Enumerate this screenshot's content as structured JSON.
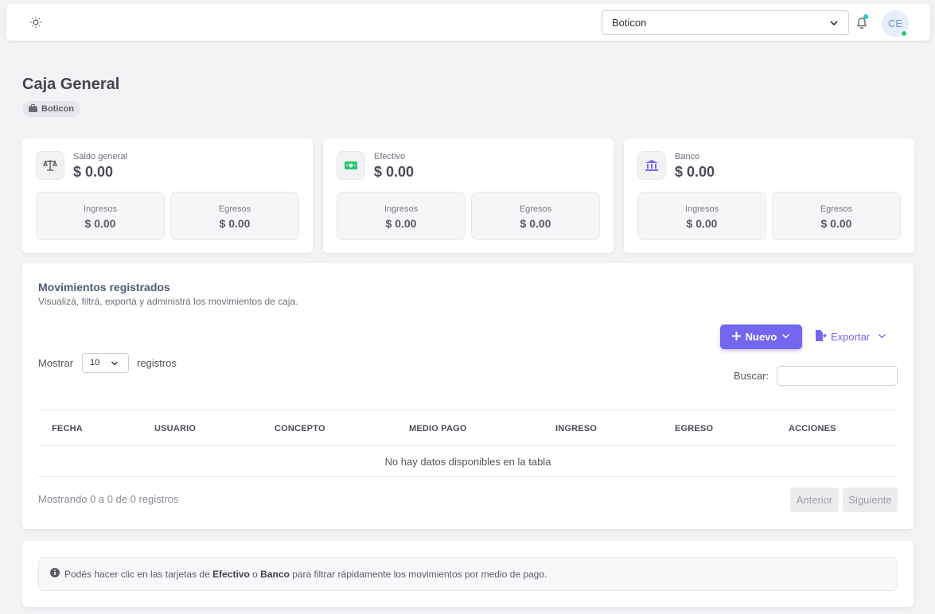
{
  "navbar": {
    "theme_icon": "sun-icon",
    "company_select": {
      "value": "Boticon"
    },
    "notifications_icon": "bell-icon",
    "avatar_initials": "CE",
    "colors": {
      "avatar_bg": "#e6eefb",
      "status_online": "#28c76f",
      "bell_dot": "#22c3d6"
    }
  },
  "page": {
    "title": "Caja General",
    "company_badge": "Boticon"
  },
  "summary_cards": [
    {
      "key": "general",
      "icon": "scale-icon",
      "label": "Saldo general",
      "value": "$ 0.00",
      "ingresos_label": "Ingresos",
      "ingresos_value": "$ 0.00",
      "egresos_label": "Egresos",
      "egresos_value": "$ 0.00"
    },
    {
      "key": "efectivo",
      "icon": "cash-icon",
      "label": "Efectivo",
      "value": "$ 0.00",
      "ingresos_label": "Ingresos",
      "ingresos_value": "$ 0.00",
      "egresos_label": "Egresos",
      "egresos_value": "$ 0.00"
    },
    {
      "key": "banco",
      "icon": "bank-icon",
      "label": "Banco",
      "value": "$ 0.00",
      "ingresos_label": "Ingresos",
      "ingresos_value": "$ 0.00",
      "egresos_label": "Egresos",
      "egresos_value": "$ 0.00"
    }
  ],
  "movements": {
    "title": "Movimientos registrados",
    "subtitle": "Visualizá, filtrá, exportá y administrá los movimientos de caja.",
    "new_button": "Nuevo",
    "export_button": "Exportar",
    "length_prefix": "Mostrar",
    "length_value": "10",
    "length_suffix": "registros",
    "search_label": "Buscar:",
    "columns": [
      "FECHA",
      "USUARIO",
      "CONCEPTO",
      "MEDIO PAGO",
      "INGRESO",
      "EGRESO",
      "ACCIONES"
    ],
    "empty_message": "No hay datos disponibles en la tabla",
    "info": "Mostrando 0 a 0 de 0 registros",
    "prev_button": "Anterior",
    "next_button": "Siguiente",
    "accent": "#7367f0"
  },
  "tip": {
    "icon": "info-icon",
    "text_1": "Podés hacer clic en las tarjetas de",
    "bold_1": "Efectivo",
    "text_2": "o",
    "bold_2": "Banco",
    "text_3": "para filtrar rápidamente los movimientos por medio de pago."
  }
}
